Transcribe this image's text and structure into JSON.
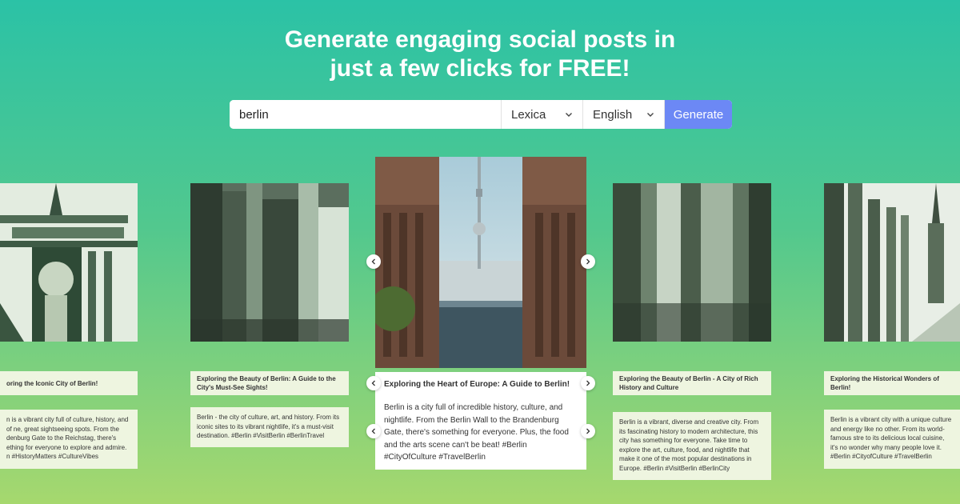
{
  "header": {
    "line1": "Generate engaging social posts in",
    "line2": "just a few clicks for FREE!"
  },
  "search": {
    "value": "berlin",
    "source_selected": "Lexica",
    "language_selected": "English",
    "generate_label": "Generate"
  },
  "colors": {
    "accent_button": "#6c88f5",
    "background_top": "#2bc2a6",
    "background_bottom": "#a6d86e"
  },
  "cards": [
    {
      "title": "oring the Iconic City of Berlin!",
      "body": "n is a vibrant city full of culture, history, and of ne, great sightseeing spots. From the denburg Gate to the Reichstag, there's ething for everyone to explore and admire. n #HistoryMatters #CultureVibes"
    },
    {
      "title": "Exploring the Beauty of Berlin: A Guide to the City's Must-See Sights!",
      "body": "Berlin - the city of culture, art, and history. From its iconic sites to its vibrant nightlife, it's a must-visit destination. #Berlin #VisitBerlin #BerlinTravel"
    },
    {
      "title": "Exploring the Heart of Europe: A Guide to Berlin!",
      "body": "Berlin is a city full of incredible history, culture, and nightlife. From the Berlin Wall to the Brandenburg Gate, there's something for everyone. Plus, the food and the arts scene can't be beat! #Berlin #CityOfCulture #TravelBerlin"
    },
    {
      "title": "Exploring the Beauty of Berlin - A City of Rich History and Culture",
      "body": "Berlin is a vibrant, diverse and creative city. From its fascinating history to modern architecture, this city has something for everyone. Take time to explore the art, culture, food, and nightlife that make it one of the most popular destinations in Europe. #Berlin #VisitBerlin #BerlinCity"
    },
    {
      "title": "Exploring the Historical Wonders of Berlin!",
      "body": "Berlin is a vibrant city with a unique culture and energy like no other. From its world-famous stre to its delicious local cuisine, it's no wonder why many people love it. #Berlin #CityofCulture #TravelBerlin"
    }
  ]
}
